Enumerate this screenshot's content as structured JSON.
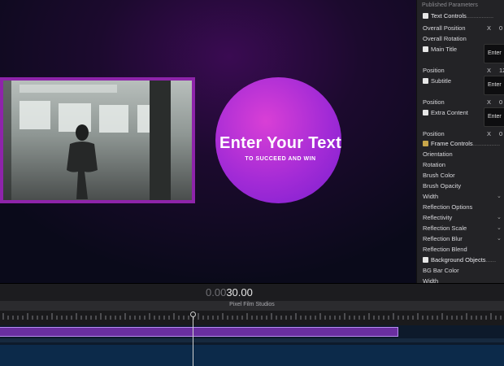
{
  "viewer": {
    "title_text": "Enter Your Text",
    "subtitle_text": "TO SUCCEED AND WIN"
  },
  "inspector": {
    "header": "Published Parameters",
    "rows": [
      {
        "label": "Text Controls",
        "type": "section",
        "dots": "................"
      },
      {
        "label": "Overall Position",
        "x": "X",
        "val": "0"
      },
      {
        "label": "Overall Rotation"
      },
      {
        "label": "Main Title",
        "type": "checkbox",
        "box": "Enter"
      },
      {
        "label": "Position",
        "x": "X",
        "val": "12"
      },
      {
        "label": "Subtitle",
        "type": "checkbox",
        "box": "Enter"
      },
      {
        "label": "Position",
        "x": "X",
        "val": "0"
      },
      {
        "label": "Extra Content",
        "type": "checkbox",
        "box": "Enter"
      },
      {
        "label": "Position",
        "x": "X",
        "val": "0"
      },
      {
        "label": "Frame Controls",
        "type": "section-gold",
        "dots": "................"
      },
      {
        "label": "Orientation"
      },
      {
        "label": "Rotation"
      },
      {
        "label": "Brush Color"
      },
      {
        "label": "Brush Opacity"
      },
      {
        "label": "Width",
        "chev": "⌄"
      },
      {
        "label": "Reflection Options"
      },
      {
        "label": "Reflectivity",
        "chev": "⌄"
      },
      {
        "label": "Reflection Scale",
        "chev": "⌄"
      },
      {
        "label": "Reflection Blur",
        "chev": "⌄"
      },
      {
        "label": "Reflection Blend"
      },
      {
        "label": "Background Objects",
        "type": "section",
        "dots": "......"
      },
      {
        "label": "BG Bar Color"
      },
      {
        "label": "Width"
      }
    ]
  },
  "timeline": {
    "timecode_dim": "0.00",
    "timecode_main": "30.00",
    "project_name": "Pixel Film Studios"
  },
  "colors": {
    "accent_purple": "#8e24aa",
    "circle": "#a32bd6",
    "clip": "#6a2fa0"
  }
}
